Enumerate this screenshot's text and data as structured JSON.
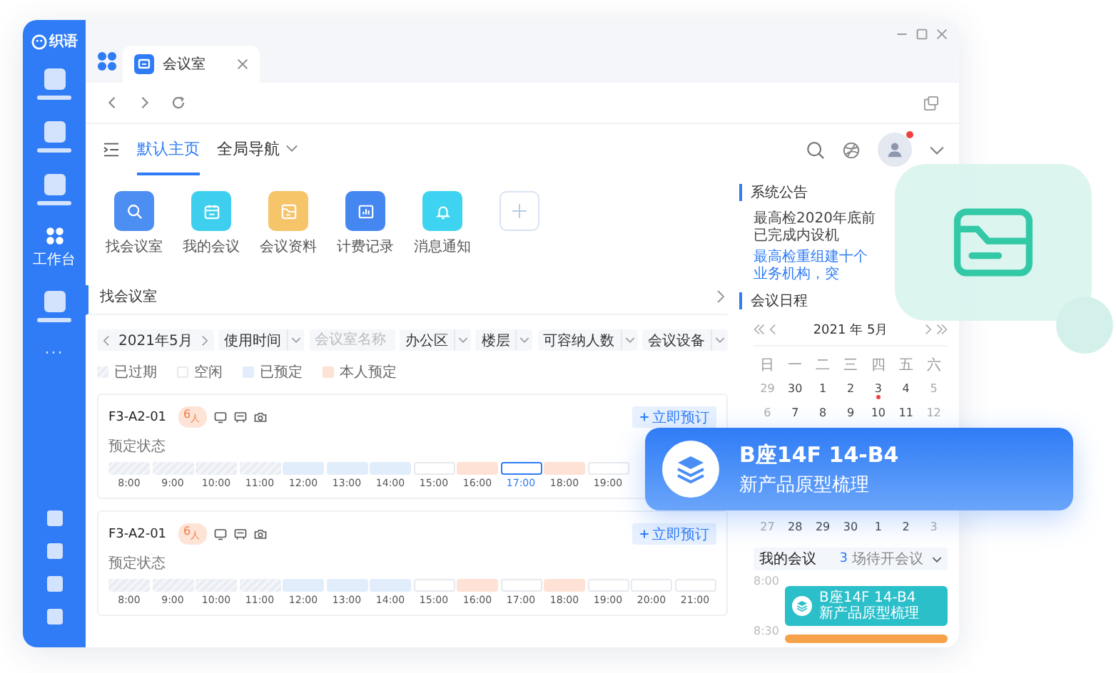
{
  "window": {
    "tab_title": "会议室"
  },
  "sidebar": {
    "logo": "织语",
    "items": [
      {
        "kind": "block",
        "selected": false
      },
      {
        "kind": "block",
        "selected": false
      },
      {
        "kind": "block",
        "selected": false
      },
      {
        "kind": "labeled",
        "label": "工作台",
        "selected": true
      },
      {
        "kind": "block",
        "selected": false
      },
      {
        "kind": "more",
        "label": "···",
        "selected": false
      }
    ],
    "bottom_items": [
      {
        "kind": "square"
      },
      {
        "kind": "square"
      },
      {
        "kind": "square"
      },
      {
        "kind": "square"
      }
    ]
  },
  "header": {
    "tabs": [
      {
        "label": "默认主页",
        "selected": true,
        "dropdown": false
      },
      {
        "label": "全局导航",
        "selected": false,
        "dropdown": true
      }
    ],
    "has_notification": true
  },
  "quick_apps": [
    {
      "label": "找会议室",
      "kind": "search",
      "color": "#4d8ef3"
    },
    {
      "label": "我的会议",
      "kind": "calendar",
      "color": "#3fcfee"
    },
    {
      "label": "会议资料",
      "kind": "document",
      "color": "#f6c469"
    },
    {
      "label": "计费记录",
      "kind": "chart",
      "color": "#4587f0"
    },
    {
      "label": "消息通知",
      "kind": "bell",
      "color": "#3ed3f0"
    }
  ],
  "find_room": {
    "title": "找会议室",
    "filters": [
      {
        "kind": "date",
        "value": "2021年5月"
      },
      {
        "kind": "dropdown",
        "label": "使用时间"
      },
      {
        "kind": "input",
        "placeholder": "会议室名称"
      },
      {
        "kind": "dropdown",
        "label": "办公区"
      },
      {
        "kind": "dropdown",
        "label": "楼层"
      },
      {
        "kind": "dropdown",
        "label": "可容纳人数"
      },
      {
        "kind": "dropdown",
        "label": "会议设备"
      }
    ],
    "legend": [
      {
        "label": "已过期",
        "kind": "past"
      },
      {
        "label": "空闲",
        "kind": "free"
      },
      {
        "label": "已预定",
        "kind": "booked"
      },
      {
        "label": "本人预定",
        "kind": "mine"
      }
    ],
    "rooms": [
      {
        "name": "F3-A2-01",
        "capacity": "6$_{人}$",
        "button": "立即预订",
        "status_label": "预定状态",
        "slots": [
          {
            "time": "8:00",
            "kind": "past",
            "selected": false
          },
          {
            "time": "9:00",
            "kind": "past",
            "selected": false
          },
          {
            "time": "10:00",
            "kind": "past",
            "selected": false
          },
          {
            "time": "11:00",
            "kind": "past",
            "selected": false
          },
          {
            "time": "12:00",
            "kind": "booked",
            "selected": false
          },
          {
            "time": "13:00",
            "kind": "booked",
            "selected": false
          },
          {
            "time": "14:00",
            "kind": "booked",
            "selected": false
          },
          {
            "time": "15:00",
            "kind": "free",
            "selected": false
          },
          {
            "time": "16:00",
            "kind": "mine",
            "selected": false
          },
          {
            "time": "17:00",
            "kind": "free",
            "selected": true
          },
          {
            "time": "18:00",
            "kind": "mine",
            "selected": false
          },
          {
            "time": "19:00",
            "kind": "free",
            "selected": false
          }
        ]
      },
      {
        "name": "F3-A2-01",
        "capacity": "6$_{人}$",
        "button": "立即预订",
        "status_label": "预定状态",
        "slots": [
          {
            "time": "8:00",
            "kind": "past",
            "selected": false
          },
          {
            "time": "9:00",
            "kind": "past",
            "selected": false
          },
          {
            "time": "10:00",
            "kind": "past",
            "selected": false
          },
          {
            "time": "11:00",
            "kind": "past",
            "selected": false
          },
          {
            "time": "12:00",
            "kind": "booked",
            "selected": false
          },
          {
            "time": "13:00",
            "kind": "booked",
            "selected": false
          },
          {
            "time": "14:00",
            "kind": "booked",
            "selected": false
          },
          {
            "time": "15:00",
            "kind": "free",
            "selected": false
          },
          {
            "time": "16:00",
            "kind": "mine",
            "selected": false
          },
          {
            "time": "17:00",
            "kind": "free",
            "selected": false
          },
          {
            "time": "18:00",
            "kind": "mine",
            "selected": false
          },
          {
            "time": "19:00",
            "kind": "free",
            "selected": false
          },
          {
            "time": "20:00",
            "kind": "free",
            "selected": false
          },
          {
            "time": "21:00",
            "kind": "free",
            "selected": false
          }
        ]
      }
    ]
  },
  "notices": {
    "title": "系统公告",
    "items": [
      {
        "text": "最高检2020年底前已完成内设机",
        "kind": "plain"
      },
      {
        "text": "最高检重组建十个业务机构，突",
        "kind": "link"
      }
    ]
  },
  "schedule": {
    "title": "会议日程",
    "month": "2021 年 5月",
    "weekdays": [
      "日",
      "一",
      "二",
      "三",
      "四",
      "五",
      "六"
    ],
    "weeks": [
      [
        {
          "day": "29",
          "dot": false
        },
        {
          "day": "30",
          "dot": false
        },
        {
          "day": "1",
          "dot": false
        },
        {
          "day": "2",
          "dot": false
        },
        {
          "day": "3",
          "dot": true
        },
        {
          "day": "4",
          "dot": false
        },
        {
          "day": "5",
          "dot": false
        }
      ],
      [
        {
          "day": "6",
          "dot": false
        },
        {
          "day": "7",
          "dot": false
        },
        {
          "day": "8",
          "dot": false
        },
        {
          "day": "9",
          "dot": false
        },
        {
          "day": "10",
          "dot": false
        },
        {
          "day": "11",
          "dot": false
        },
        {
          "day": "12",
          "dot": false
        }
      ],
      [
        {
          "day": "27",
          "dot": false
        },
        {
          "day": "28",
          "dot": false
        },
        {
          "day": "29",
          "dot": false
        },
        {
          "day": "30",
          "dot": false
        },
        {
          "day": "1",
          "dot": false
        },
        {
          "day": "2",
          "dot": false
        },
        {
          "day": "3",
          "dot": false
        }
      ]
    ]
  },
  "my_meetings": {
    "title": "我的会议",
    "count": "3",
    "count_label": "场待开会议",
    "times": [
      "8:00",
      "8:30"
    ],
    "events": [
      {
        "title": "B座14F 14-B4",
        "subtitle": "新产品原型梳理",
        "color": "#2bbfca"
      },
      {
        "color": "#f5a24a"
      }
    ]
  },
  "toast": {
    "title": "B座14F 14-B4",
    "subtitle": "新产品原型梳理"
  }
}
